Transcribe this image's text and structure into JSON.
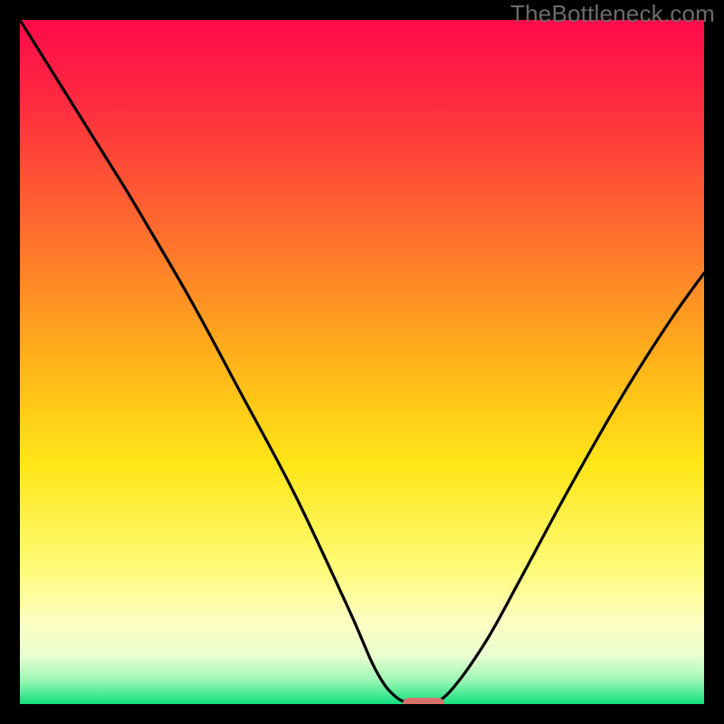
{
  "attribution": "TheBottleneck.com",
  "colors": {
    "frame": "#000000",
    "curve": "#000000",
    "marker": "#d7726b",
    "gradient_stops": [
      {
        "offset": 0.0,
        "color": "#ff0a4a"
      },
      {
        "offset": 0.12,
        "color": "#ff2b3f"
      },
      {
        "offset": 0.3,
        "color": "#ff6a2f"
      },
      {
        "offset": 0.5,
        "color": "#ffb319"
      },
      {
        "offset": 0.65,
        "color": "#ffe617"
      },
      {
        "offset": 0.8,
        "color": "#fffb77"
      },
      {
        "offset": 0.88,
        "color": "#fdffc2"
      },
      {
        "offset": 0.93,
        "color": "#e8ffd0"
      },
      {
        "offset": 0.965,
        "color": "#9cf7b5"
      },
      {
        "offset": 1.0,
        "color": "#12e07e"
      }
    ]
  },
  "chart_data": {
    "type": "line",
    "title": "",
    "xlabel": "",
    "ylabel": "",
    "xlim": [
      0,
      100
    ],
    "ylim": [
      0,
      100
    ],
    "series": [
      {
        "name": "bottleneck-curve",
        "x": [
          0,
          5,
          10,
          15,
          18,
          25,
          32,
          40,
          48,
          52,
          55,
          58,
          60,
          63,
          68,
          73,
          80,
          88,
          95,
          100
        ],
        "y": [
          100,
          92,
          84,
          76,
          71,
          59,
          46,
          31,
          14,
          5,
          1,
          0,
          0,
          2,
          9,
          18,
          31,
          45,
          56,
          63
        ]
      }
    ],
    "marker": {
      "x": 59,
      "y": 0,
      "width_pct": 6
    },
    "annotations": []
  }
}
